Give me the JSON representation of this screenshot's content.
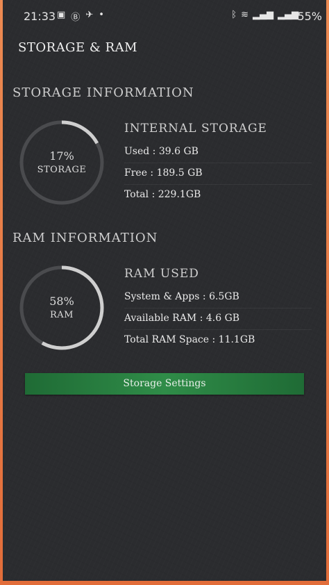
{
  "status_bar": {
    "time": "21:33",
    "battery": "55%",
    "left_icons": [
      "image-icon",
      "b-icon",
      "plane-icon",
      "dot-icon"
    ],
    "right_icons": [
      "bluetooth-icon",
      "wifi-icon",
      "signal-icon",
      "signal-icon"
    ]
  },
  "app_title": "STORAGE & RAM",
  "storage": {
    "section_title": "STORAGE INFORMATION",
    "ring_percent": "17%",
    "ring_label": "STORAGE",
    "ring_fraction": 0.17,
    "heading": "INTERNAL STORAGE",
    "used": "Used : 39.6 GB",
    "free": "Free : 189.5 GB",
    "total": "Total : 229.1GB"
  },
  "ram": {
    "section_title": "RAM INFORMATION",
    "ring_percent": "58%",
    "ring_label": "RAM",
    "ring_fraction": 0.58,
    "heading": "RAM USED",
    "system_apps": "System & Apps : 6.5GB",
    "available": "Available RAM : 4.6 GB",
    "total": "Total RAM Space : 11.1GB"
  },
  "settings_button": "Storage Settings",
  "colors": {
    "ring_track": "#4a4b4e",
    "ring_progress": "#cfcfcf",
    "button_green": "#2f8c48"
  }
}
